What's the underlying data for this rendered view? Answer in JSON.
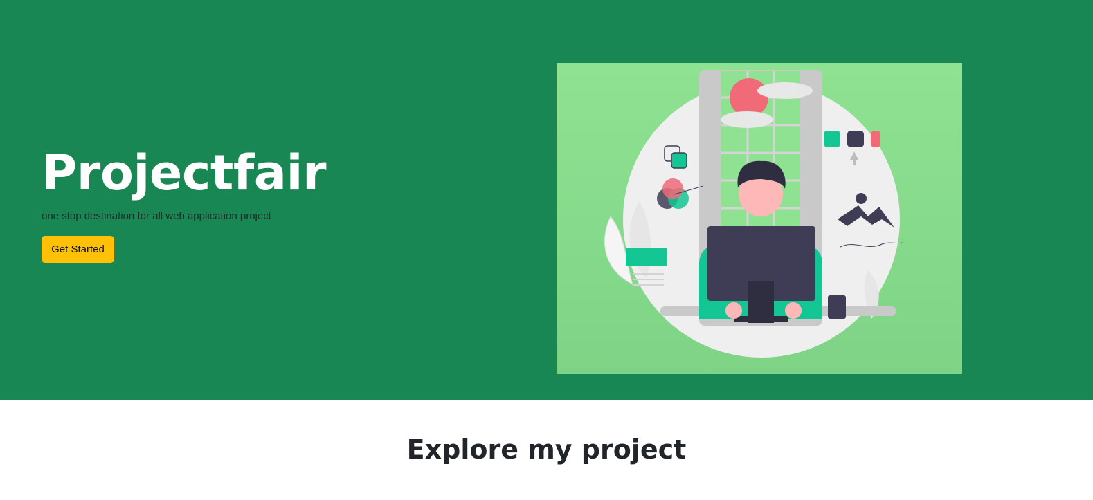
{
  "hero": {
    "title": "Projectfair",
    "subtitle": "one stop destination for all web application project",
    "cta_label": "Get Started",
    "illustration": "developer-at-desk-illustration"
  },
  "colors": {
    "hero_bg": "#198754",
    "button_bg": "#ffc107",
    "illustration_bg": "#8bdf8e",
    "accent_teal": "#14c693",
    "accent_red": "#f06a78",
    "dark": "#3f3d56"
  },
  "projects": {
    "heading": "Explore my project"
  }
}
